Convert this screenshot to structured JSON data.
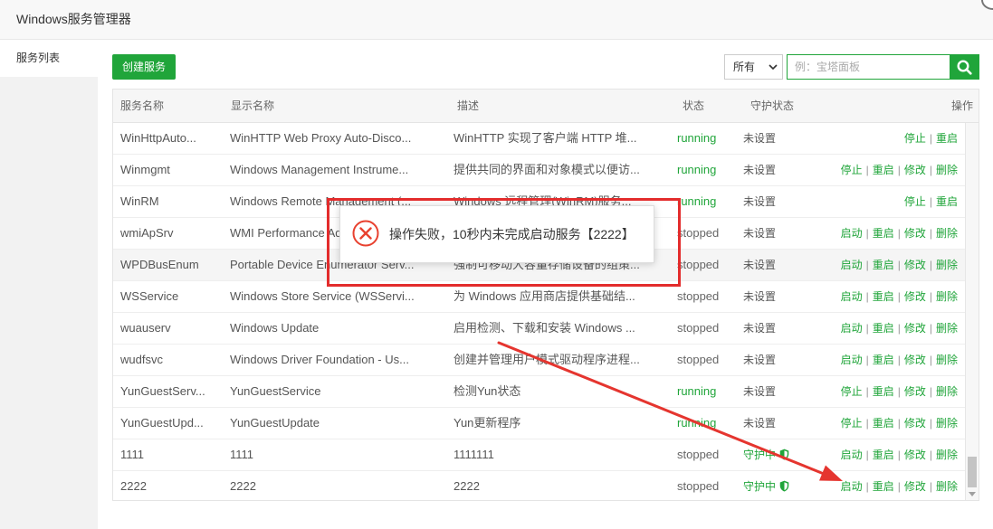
{
  "window": {
    "title": "Windows服务管理器",
    "close_icon": "close-icon"
  },
  "sidebar": {
    "items": [
      {
        "label": "服务列表",
        "active": true
      }
    ]
  },
  "toolbar": {
    "create_label": "创建服务",
    "filter_selected": "所有",
    "filter_icon": "chevron-down-icon",
    "search_placeholder": "例：宝塔面板",
    "search_icon": "search-icon"
  },
  "table": {
    "headers": {
      "name": "服务名称",
      "display": "显示名称",
      "desc": "描述",
      "status": "状态",
      "guard": "守护状态",
      "actions": "操作"
    },
    "action_separator": "|",
    "rows": [
      {
        "name": "WinHttpAuto...",
        "display": "WinHTTP Web Proxy Auto-Disco...",
        "desc": "WinHTTP 实现了客户端 HTTP 堆...",
        "status": "running",
        "guard": "未设置",
        "actions": [
          "停止",
          "重启"
        ]
      },
      {
        "name": "Winmgmt",
        "display": "Windows Management Instrume...",
        "desc": "提供共同的界面和对象模式以便访...",
        "status": "running",
        "guard": "未设置",
        "actions": [
          "停止",
          "重启",
          "修改",
          "删除"
        ]
      },
      {
        "name": "WinRM",
        "display": "Windows Remote Management (...",
        "desc": "Windows 远程管理(WinRM)服务...",
        "status": "running",
        "guard": "未设置",
        "actions": [
          "停止",
          "重启"
        ]
      },
      {
        "name": "wmiApSrv",
        "display": "WMI Performance Adapter",
        "desc": "",
        "status": "stopped",
        "guard": "未设置",
        "actions": [
          "启动",
          "重启",
          "修改",
          "删除"
        ]
      },
      {
        "name": "WPDBusEnum",
        "display": "Portable Device Enumerator Serv...",
        "desc": "强制可移动大容量存储设备的组策...",
        "status": "stopped",
        "guard": "未设置",
        "actions": [
          "启动",
          "重启",
          "修改",
          "删除"
        ],
        "hovered": true
      },
      {
        "name": "WSService",
        "display": "Windows Store Service (WSServi...",
        "desc": "为 Windows 应用商店提供基础结...",
        "status": "stopped",
        "guard": "未设置",
        "actions": [
          "启动",
          "重启",
          "修改",
          "删除"
        ]
      },
      {
        "name": "wuauserv",
        "display": "Windows Update",
        "desc": "启用检测、下载和安装 Windows ...",
        "status": "stopped",
        "guard": "未设置",
        "actions": [
          "启动",
          "重启",
          "修改",
          "删除"
        ]
      },
      {
        "name": "wudfsvc",
        "display": "Windows Driver Foundation - Us...",
        "desc": "创建并管理用户模式驱动程序进程...",
        "status": "stopped",
        "guard": "未设置",
        "actions": [
          "启动",
          "重启",
          "修改",
          "删除"
        ]
      },
      {
        "name": "YunGuestServ...",
        "display": "YunGuestService",
        "desc": "检测Yun状态",
        "status": "running",
        "guard": "未设置",
        "actions": [
          "停止",
          "重启",
          "修改",
          "删除"
        ]
      },
      {
        "name": "YunGuestUpd...",
        "display": "YunGuestUpdate",
        "desc": "Yun更新程序",
        "status": "running",
        "guard": "未设置",
        "actions": [
          "停止",
          "重启",
          "修改",
          "删除"
        ]
      },
      {
        "name": "1111",
        "display": "1111",
        "desc": "1111111",
        "status": "stopped",
        "guard": "守护中",
        "guard_icon": "shield-icon",
        "actions": [
          "启动",
          "重启",
          "修改",
          "删除"
        ]
      },
      {
        "name": "2222",
        "display": "2222",
        "desc": "2222",
        "status": "stopped",
        "guard": "守护中",
        "guard_icon": "shield-icon",
        "actions": [
          "启动",
          "重启",
          "修改",
          "删除"
        ]
      }
    ]
  },
  "toast": {
    "icon": "error-circle-icon",
    "message": "操作失败，10秒内未完成启动服务【2222】"
  },
  "colors": {
    "accent": "#20a53a",
    "running": "#20a53a",
    "stopped": "#666666",
    "error": "#e8412f",
    "annotation": "#e32c2c"
  }
}
